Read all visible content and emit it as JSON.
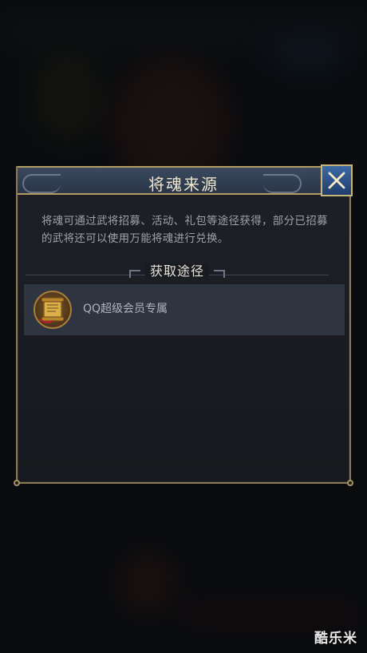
{
  "dialog": {
    "title": "将魂来源",
    "description": "将魂可通过武将招募、活动、礼包等途径获得，部分已招募的武将还可以使用万能将魂进行兑换。",
    "section_title": "获取途径",
    "sources": [
      {
        "label": "QQ超级会员专属",
        "icon": "scroll-icon"
      }
    ],
    "close_icon": "close-icon"
  },
  "watermark": "酷乐米",
  "colors": {
    "frame_gold": "#b39b62",
    "title_bar": "#2a3547",
    "close_button": "#2f5a96",
    "row_bg": "#2e3440"
  }
}
